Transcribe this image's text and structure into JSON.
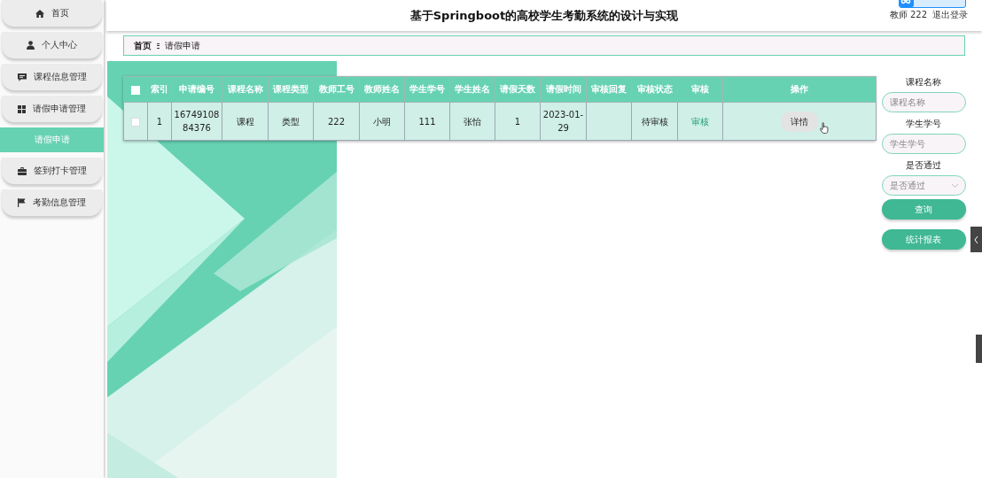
{
  "header": {
    "title": "基于Springboot的高校学生考勤系统的设计与实现",
    "user": "教师 222",
    "logout": "退出登录"
  },
  "sidebar": {
    "items": [
      {
        "label": "首页",
        "selected": false
      },
      {
        "label": "个人中心",
        "selected": false
      },
      {
        "label": "课程信息管理",
        "selected": false
      },
      {
        "label": "请假申请管理",
        "selected": false
      },
      {
        "label": "请假申请",
        "selected": true
      },
      {
        "label": "签到打卡管理",
        "selected": false
      },
      {
        "label": "考勤信息管理",
        "selected": false
      }
    ]
  },
  "breadcrumb": [
    "首页",
    "请假申请"
  ],
  "table": {
    "select_all_checked": false,
    "columns": [
      "索引",
      "申请编号",
      "课程名称",
      "课程类型",
      "教师工号",
      "教师姓名",
      "学生学号",
      "学生姓名",
      "请假天数",
      "请假时间",
      "审核回复",
      "审核状态",
      "审核",
      "操作"
    ],
    "rows": [
      {
        "checked": false,
        "cells": [
          "1",
          "1674910884376",
          "课程",
          "类型",
          "222",
          "小明",
          "111",
          "张怡",
          "1",
          "2023-01-29",
          "",
          "待审核"
        ],
        "review_link": "审核",
        "action": "详情"
      }
    ]
  },
  "search": {
    "fields": [
      {
        "label": "课程名称",
        "placeholder": "课程名称",
        "kind": "text"
      },
      {
        "label": "学生学号",
        "placeholder": "学生学号",
        "kind": "text"
      },
      {
        "label": "是否通过",
        "placeholder": "是否通过",
        "kind": "select"
      }
    ],
    "buttons": [
      "查询",
      "统计报表"
    ]
  }
}
